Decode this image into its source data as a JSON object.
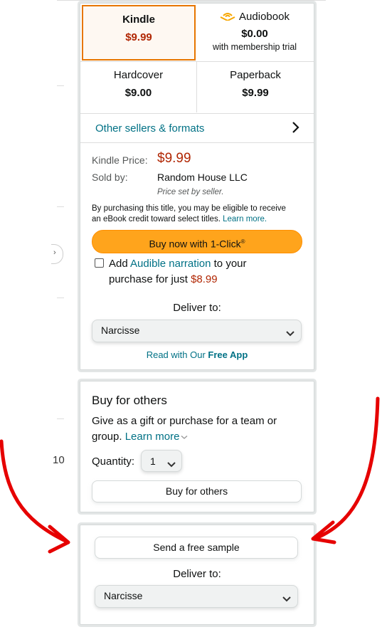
{
  "formats": {
    "kindle": {
      "name": "Kindle",
      "price": "$9.99"
    },
    "audiobook": {
      "name": "Audiobook",
      "price": "$0.00",
      "sub": "with membership trial"
    },
    "hardcover": {
      "name": "Hardcover",
      "price": "$9.00"
    },
    "paperback": {
      "name": "Paperback",
      "price": "$9.99"
    }
  },
  "other_sellers": {
    "label": "Other sellers & formats",
    "icon": "chevron-right-icon"
  },
  "buybox": {
    "kindle_price_label": "Kindle Price:",
    "kindle_price": "$9.99",
    "sold_by_label": "Sold by:",
    "sold_by": "Random House LLC",
    "price_set": "Price set by seller.",
    "credit_text_1": "By purchasing this title, you may be eligible to receive",
    "credit_text_2": "an eBook credit toward select titles.",
    "learn_more": "Learn more.",
    "buy_now": "Buy now with 1-Click",
    "buy_now_mark": "®",
    "add": "Add",
    "audible_narration": "Audible narration",
    "to_your": "to your",
    "purchase_for": "purchase for just",
    "narration_price": "$8.99",
    "deliver_to": "Deliver to:",
    "device": "Narcisse",
    "read_with": "Read with Our",
    "free_app": "Free App"
  },
  "buy_for_others": {
    "heading": "Buy for others",
    "desc_1": "Give as a gift or purchase for a team or",
    "desc_2": "group.",
    "learn_more": "Learn more",
    "quantity_label": "Quantity:",
    "quantity": "1",
    "button": "Buy for others"
  },
  "free_sample": {
    "button": "Send a free sample",
    "deliver_to": "Deliver to:",
    "device": "Narcisse"
  },
  "background": {
    "edge_text": "10"
  },
  "colors": {
    "accent_orange": "#e77600",
    "price_red": "#b12704",
    "link_teal": "#007185",
    "button_yellow": "#ffa41c",
    "annotation_red": "#e60000"
  }
}
